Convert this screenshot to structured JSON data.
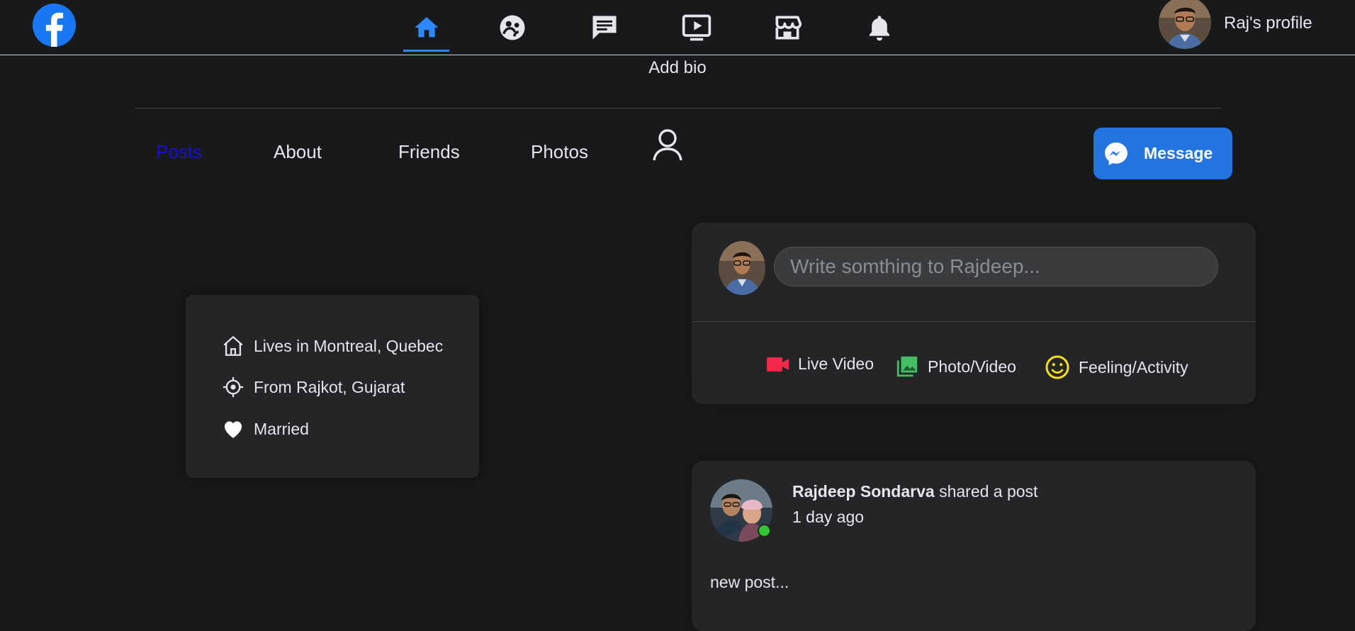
{
  "topbar": {
    "logo": "facebook-logo",
    "nav_icons": [
      "home-icon",
      "groups-icon",
      "messages-icon",
      "watch-icon",
      "marketplace-icon",
      "notifications-icon"
    ],
    "active_nav": "home-icon",
    "profile_name": "Raj's profile"
  },
  "profile": {
    "add_bio": "Add bio"
  },
  "tabs": {
    "posts": "Posts",
    "about": "About",
    "friends": "Friends",
    "photos": "Photos",
    "active": "Posts"
  },
  "message_button": {
    "label": "Message"
  },
  "intro": {
    "lives_in": "Lives in Montreal, Quebec",
    "from": "From Rajkot, Gujarat",
    "relationship": "Married"
  },
  "composer": {
    "placeholder": "Write somthing to Rajdeep...",
    "live_video": "Live Video",
    "photo_video": "Photo/Video",
    "feeling": "Feeling/Activity"
  },
  "post": {
    "author": "Rajdeep Sondarva",
    "action": "shared a post",
    "time": "1 day ago",
    "text": "new post..."
  },
  "colors": {
    "background": "#18191a",
    "card": "#242526",
    "accent": "#2d88ff",
    "message_button": "#2374e1",
    "active_tab": "#1a0dd6",
    "live_video": "#f02849",
    "photo_video": "#45bd62",
    "feeling": "#f7b928",
    "online": "#31c731"
  }
}
